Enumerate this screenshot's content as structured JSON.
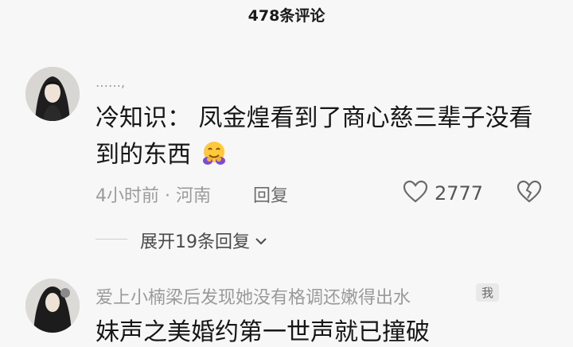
{
  "header": {
    "title": "478条评论"
  },
  "comments": [
    {
      "username": "……,",
      "text": "冷知识： 凤金煌看到了商心慈三辈子没看到的东西",
      "emoji": "hugging-face-emoji",
      "meta": "4小时前 · 河南",
      "reply_label": "回复",
      "likes": "2777",
      "expand_label": "展开19条回复"
    },
    {
      "username": "爱上小楠梁后发现她没有格调还嫩得出水",
      "badge": "我",
      "text_partial": "妹声之美婚约第一世声就已撞破"
    }
  ],
  "colors": {
    "text": "#161616",
    "muted": "#9a9a9a",
    "background": "#f7f7f7"
  }
}
